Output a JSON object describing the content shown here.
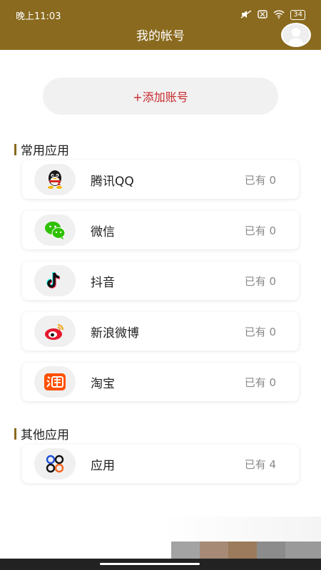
{
  "status_bar": {
    "time": "晚上11:03",
    "battery": "34"
  },
  "header": {
    "title": "我的帐号"
  },
  "add_button": {
    "label": "+添加账号"
  },
  "sections": [
    {
      "title": "常用应用",
      "items": [
        {
          "name": "腾讯QQ",
          "count": "已有 0",
          "icon": "qq-icon"
        },
        {
          "name": "微信",
          "count": "已有 0",
          "icon": "wechat-icon"
        },
        {
          "name": "抖音",
          "count": "已有 0",
          "icon": "douyin-icon"
        },
        {
          "name": "新浪微博",
          "count": "已有 0",
          "icon": "weibo-icon"
        },
        {
          "name": "淘宝",
          "count": "已有 0",
          "icon": "taobao-icon"
        }
      ]
    },
    {
      "title": "其他应用",
      "items": [
        {
          "name": "应用",
          "count": "已有 4",
          "icon": "apps-icon"
        }
      ]
    }
  ],
  "colors": {
    "header": "#8a6a1e",
    "accent_red": "#c8272b",
    "section_bar": "#8a6a1e"
  }
}
